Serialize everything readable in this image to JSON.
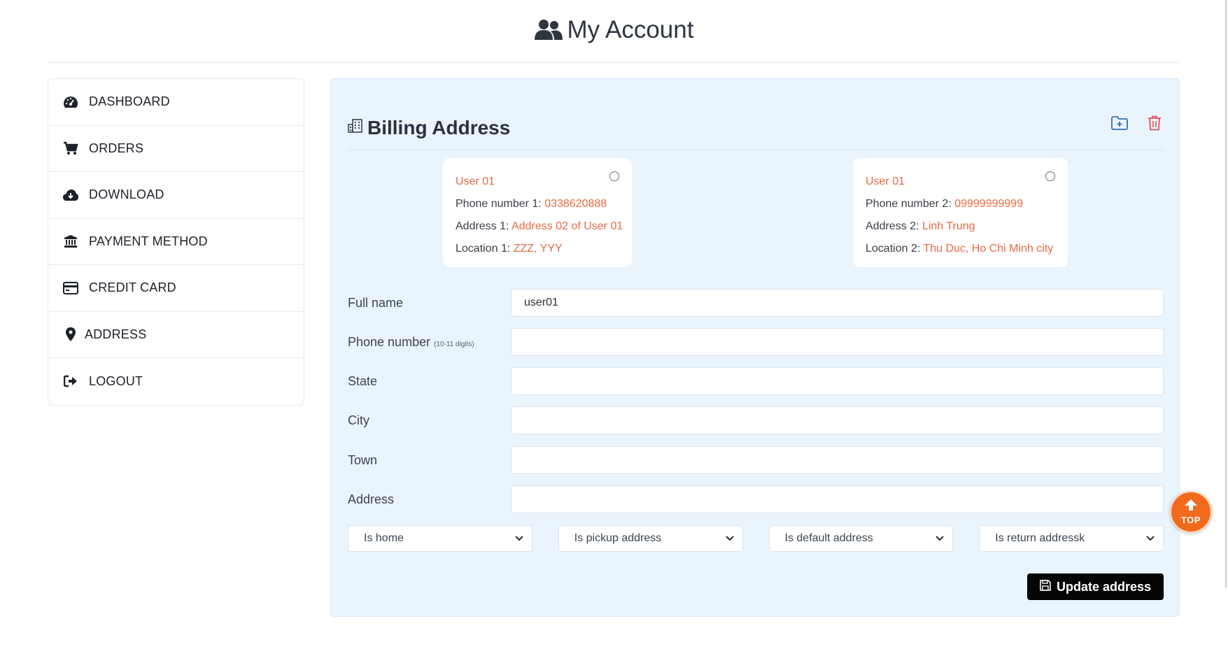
{
  "header": {
    "title": "My Account",
    "icon": "users-icon"
  },
  "sidebar": {
    "items": [
      {
        "label": "DASHBOARD",
        "icon": "gauge-icon"
      },
      {
        "label": "ORDERS",
        "icon": "cart-icon"
      },
      {
        "label": "DOWNLOAD",
        "icon": "cloud-download-icon"
      },
      {
        "label": "PAYMENT METHOD",
        "icon": "bank-icon"
      },
      {
        "label": "CREDIT CARD",
        "icon": "credit-card-icon"
      },
      {
        "label": "ADDRESS",
        "icon": "map-pin-icon"
      },
      {
        "label": "LOGOUT",
        "icon": "logout-icon"
      }
    ]
  },
  "billing": {
    "title": "Billing Address",
    "icon": "building-icon",
    "actions": {
      "add_icon": "folder-plus-icon",
      "delete_icon": "trash-icon"
    },
    "addresses": [
      {
        "name": "User 01",
        "phone_label": "Phone number 1:",
        "phone": "0338620888",
        "address_label": "Address 1:",
        "address": "Address 02 of User 01",
        "location_label": "Location 1:",
        "location": "ZZZ, YYY"
      },
      {
        "name": "User 01",
        "phone_label": "Phone number 2:",
        "phone": "09999999999",
        "address_label": "Address 2:",
        "address": "Linh Trung",
        "location_label": "Location 2:",
        "location": "Thu Duc, Ho Chi Minh city"
      }
    ]
  },
  "form": {
    "fullname_label": "Full name",
    "fullname_value": "user01",
    "phone_label": "Phone number",
    "phone_hint": "(10-11 digits)",
    "phone_value": "",
    "state_label": "State",
    "state_value": "",
    "city_label": "City",
    "city_value": "",
    "town_label": "Town",
    "town_value": "",
    "address_label": "Address",
    "address_value": "",
    "selects": [
      "Is home",
      "Is pickup address",
      "Is default address",
      "Is return addressk"
    ],
    "update_label": "Update address"
  },
  "scroll_top": {
    "label": "TOP"
  }
}
